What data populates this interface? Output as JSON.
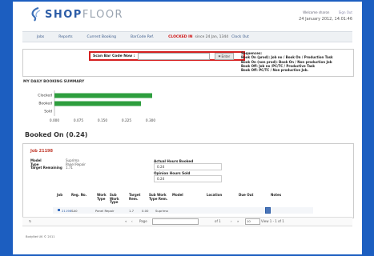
{
  "header": {
    "logo_part1": "SHOP",
    "logo_part2": "FLOOR",
    "welcome": "Welcome sharon",
    "signout": "Sign Out",
    "datetime": "24 January 2012, 14:01:46"
  },
  "nav": {
    "jobs": "Jobs",
    "reports": "Reports",
    "current_booking": "Current Booking",
    "barcode_ref": "BarCode Ref.",
    "clocked_in": "CLOCKED IN",
    "since": "since 24 Jan, 1344",
    "clock_out": "Clock Out"
  },
  "scan": {
    "label": "Scan Bar Code Now :",
    "value": "",
    "enter": "Enter"
  },
  "sequences": {
    "title": "Sequences:",
    "lines": [
      "Book On (prod): Job no / Book On / Production Task",
      "Book On (non prod): Book On / Non production Job",
      "Book Off: Job no /PC/TC / Productive Task",
      "Book Off: PC/TC / Non productive Job."
    ]
  },
  "summary": {
    "title": "MY DAILY BOOKING SUMMARY"
  },
  "chart_data": {
    "type": "bar",
    "orientation": "horizontal",
    "categories": [
      "Clocked",
      "Booked",
      "Sold"
    ],
    "values": [
      0.305,
      0.27,
      0
    ],
    "xlim": [
      0,
      0.3
    ],
    "xticks": [
      "0.000",
      "0.075",
      "0.150",
      "0.225",
      "0.300"
    ],
    "color": "#2e9e3e"
  },
  "booked_on": "Booked On (0.24)",
  "job": {
    "number": "Job 21198",
    "model_label": "Model",
    "model": "Suprima",
    "type_label": "Type",
    "type": "Panel Repair",
    "target_label": "Target Remaining",
    "target": "1.71",
    "actual_label": "Actual Hours Booked",
    "actual": "0.24",
    "opinion_label": "Opinion Hours Sold",
    "opinion": "0.24"
  },
  "table": {
    "headers": {
      "job": "Job",
      "reg": "Reg. No.",
      "work_type": "Work Type",
      "sub_work_type": "Sub Work Type",
      "target_rem": "Target Rem.",
      "sub_work_type_rem": "Sub Work Type Rem.",
      "model": "Model",
      "location": "Location",
      "due_out": "Due Out",
      "notes": "Notes"
    },
    "row": {
      "job": "21198",
      "reg": "SA0",
      "work_type": "Panel Repair",
      "target_rem": "1.7",
      "sub_rem": "0.00",
      "model": "Suprima"
    }
  },
  "pager": {
    "page_label": "Page",
    "of": "of 1",
    "per_page": "10",
    "view": "View 1 - 1 of 1"
  },
  "footer": "BodyNet UK © 2011"
}
